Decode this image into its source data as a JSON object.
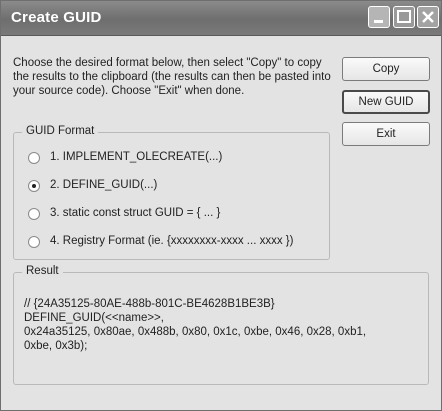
{
  "window": {
    "title": "Create GUID",
    "controls": {
      "minimize_icon": "minimize-icon",
      "maximize_icon": "maximize-icon",
      "close_icon": "close-icon"
    }
  },
  "intro_text": "Choose the desired format below, then select \"Copy\" to copy the results to the clipboard (the results can then be pasted into your source code). Choose \"Exit\" when done.",
  "buttons": {
    "copy": "Copy",
    "new_guid": "New GUID",
    "exit": "Exit"
  },
  "guid_format": {
    "legend": "GUID Format",
    "options": [
      {
        "label": "1. IMPLEMENT_OLECREATE(...)",
        "checked": false
      },
      {
        "label": "2. DEFINE_GUID(...)",
        "checked": true
      },
      {
        "label": "3. static const struct GUID = { ... }",
        "checked": false
      },
      {
        "label": "4. Registry Format (ie. {xxxxxxxx-xxxx ... xxxx })",
        "checked": false
      }
    ]
  },
  "result": {
    "legend": "Result",
    "text": "// {24A35125-80AE-488b-801C-BE4628B1BE3B}\nDEFINE_GUID(<<name>>,\n0x24a35125, 0x80ae, 0x488b, 0x80, 0x1c, 0xbe, 0x46, 0x28, 0xb1,\n0xbe, 0x3b);"
  }
}
